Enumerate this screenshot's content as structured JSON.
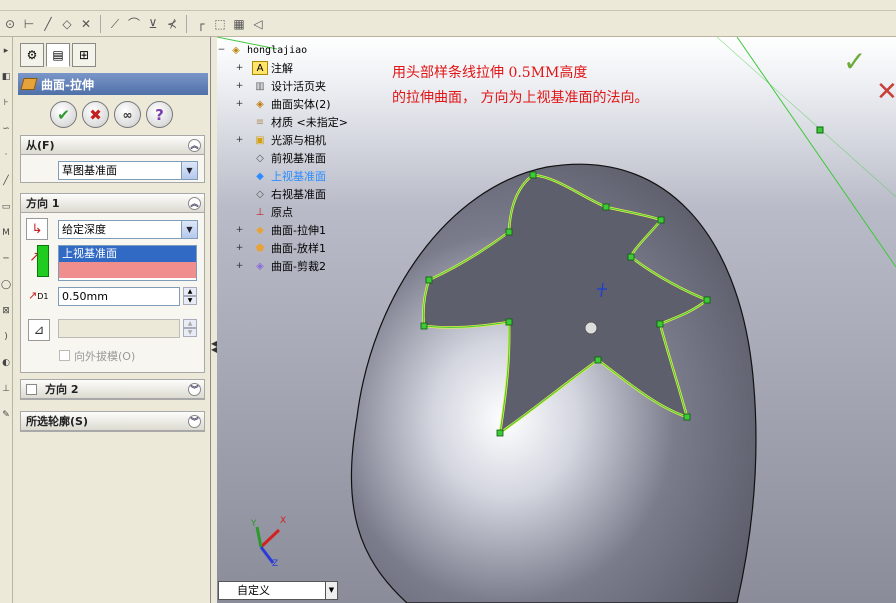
{
  "property_manager": {
    "title": "曲面-拉伸",
    "from_group": {
      "title": "从(F)",
      "start_condition": "草图基准面"
    },
    "direction1_group": {
      "title": "方向 1",
      "end_condition": "给定深度",
      "selected_plane": "上视基准面",
      "depth_value": "0.50mm",
      "depth_icon_label": "D1",
      "draft_outward_label": "向外拔模(O)"
    },
    "direction2_group": {
      "title": "方向 2"
    },
    "selected_contours_group": {
      "title": "所选轮廓(S)"
    }
  },
  "feature_tree": {
    "root": "honglajiao",
    "items": [
      {
        "label": "注解",
        "icon": "annotation-icon",
        "expandable": true
      },
      {
        "label": "设计活页夹",
        "icon": "design-binder-icon",
        "expandable": true
      },
      {
        "label": "曲面实体(2)",
        "icon": "surface-bodies-icon",
        "expandable": true
      },
      {
        "label": "材质 <未指定>",
        "icon": "material-icon",
        "expandable": false
      },
      {
        "label": "光源与相机",
        "icon": "lights-camera-icon",
        "expandable": true
      },
      {
        "label": "前视基准面",
        "icon": "plane-icon",
        "expandable": false
      },
      {
        "label": "上视基准面",
        "icon": "plane-icon",
        "expandable": false,
        "selected": true
      },
      {
        "label": "右视基准面",
        "icon": "plane-icon",
        "expandable": false
      },
      {
        "label": "原点",
        "icon": "origin-icon",
        "expandable": false
      },
      {
        "label": "曲面-拉伸1",
        "icon": "extruded-surface-icon",
        "expandable": true
      },
      {
        "label": "曲面-放样1",
        "icon": "lofted-surface-icon",
        "expandable": true
      },
      {
        "label": "曲面-剪裁2",
        "icon": "trimmed-surface-icon",
        "expandable": true
      }
    ]
  },
  "annotation": {
    "line1": "用头部样条线拉伸 0.5MM高度",
    "line2": "的拉伸曲面， 方向为上视基准面的法向。",
    "color": "#e21515"
  },
  "view_orientation": {
    "value": "自定义"
  },
  "triad": {
    "x": "X",
    "y": "Y",
    "z": "Z"
  },
  "colors": {
    "title_bar": "#4f6fa8",
    "selection": "#316ac5",
    "sketch": "#3ec83a",
    "accent_red": "#c42020"
  }
}
